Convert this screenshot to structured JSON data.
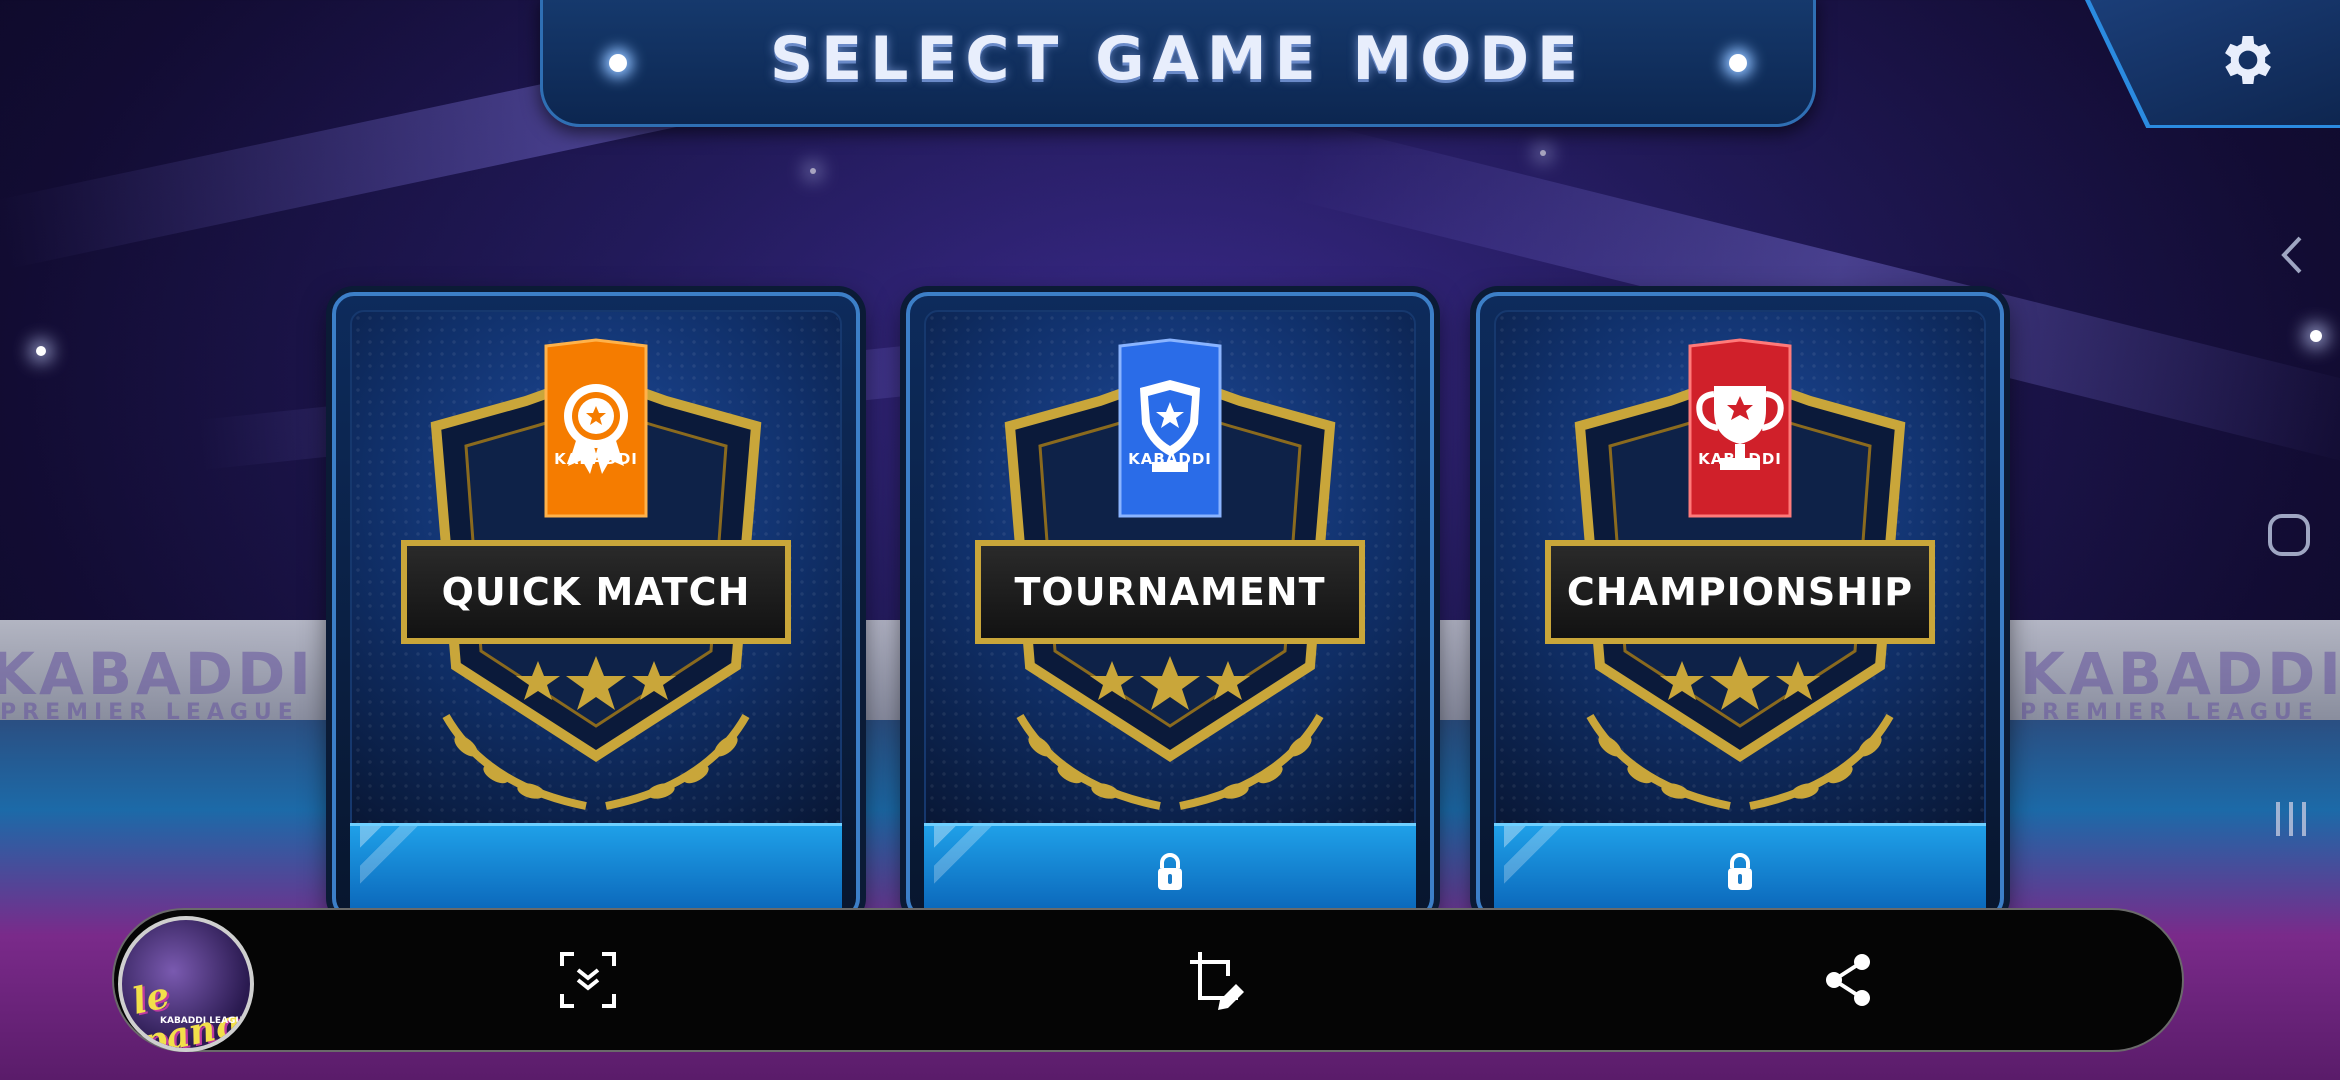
{
  "header": {
    "title": "SELECT GAME MODE"
  },
  "settings": {
    "icon": "gear-icon"
  },
  "background": {
    "banner_left": "KABADDI",
    "banner_left_sub": "PREMIER LEAGUE",
    "banner_right": "KABADDI",
    "banner_right_sub": "PREMIER LEAGUE"
  },
  "modes": [
    {
      "label": "QUICK MATCH",
      "badge_text": "KABADDI",
      "badge_color": "#f57c00",
      "emblem": "medal-icon",
      "locked": false
    },
    {
      "label": "TOURNAMENT",
      "badge_text": "KABADDI",
      "badge_color": "#2a6ce8",
      "emblem": "shield-star-icon",
      "locked": true
    },
    {
      "label": "CHAMPIONSHIP",
      "badge_text": "KABADDI",
      "badge_color": "#d0202a",
      "emblem": "trophy-icon",
      "locked": true
    }
  ],
  "system_nav": {
    "back": "back-icon",
    "home": "home-icon",
    "recents": "recents-icon"
  },
  "capture_toolbar": {
    "thumbnail": {
      "title": "le panga",
      "subtitle": "KABADDI LEAGUE"
    },
    "tools": [
      "scroll-capture-icon",
      "crop-edit-icon",
      "share-icon"
    ]
  }
}
